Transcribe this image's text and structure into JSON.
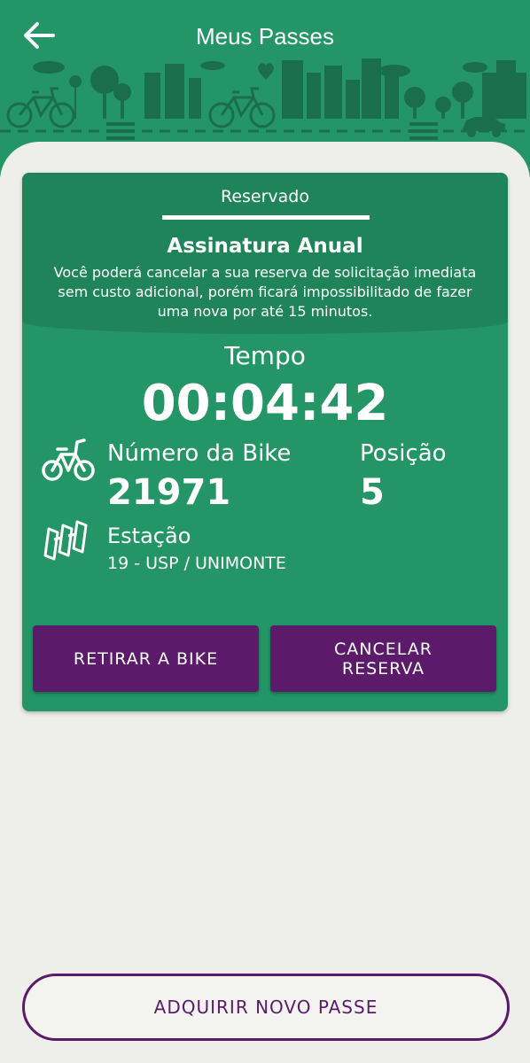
{
  "header": {
    "title": "Meus Passes",
    "back_icon": "arrow-left-icon",
    "background_color": "#239566"
  },
  "reservation": {
    "status": "Reservado",
    "plan": "Assinatura Anual",
    "description": "Você poderá cancelar a sua reserva de solicitação imediata sem custo adicional, porém  ficará impossibilitado de fazer uma nova por até 15 minutos.",
    "time_label": "Tempo",
    "time_value": "00:04:42",
    "bike_label": "Número da Bike",
    "bike_number": "21971",
    "position_label": "Posição",
    "position_value": "5",
    "station_label": "Estação",
    "station_value": "19 - USP / UNIMONTE",
    "bike_icon": "bicycle-icon",
    "station_icon": "bike-station-icon",
    "card_color": "#239566"
  },
  "actions": {
    "retirar_label": "RETIRAR A BIKE",
    "cancelar_label": "CANCELAR RESERVA",
    "button_color": "#5b1a6a"
  },
  "footer": {
    "new_pass_label": "ADQUIRIR NOVO PASSE"
  }
}
